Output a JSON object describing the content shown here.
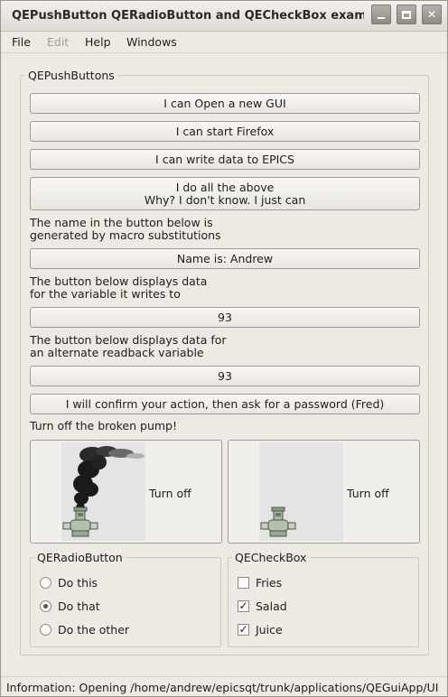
{
  "window": {
    "title": "QEPushButton QERadioButton and QECheckBox exam"
  },
  "menu": {
    "items": [
      {
        "label": "File",
        "enabled": true
      },
      {
        "label": "Edit",
        "enabled": false
      },
      {
        "label": "Help",
        "enabled": true
      },
      {
        "label": "Windows",
        "enabled": true
      }
    ]
  },
  "push_group": {
    "title": "QEPushButtons",
    "btn_open_gui": "I can Open a new GUI",
    "btn_firefox": "I can start Firefox",
    "btn_write_epics": "I can write data to EPICS",
    "btn_all_line1": "I do all the above",
    "btn_all_line2": "Why? I don't know. I just can",
    "macro_label_line1": "The name in the button below is",
    "macro_label_line2": "generated by macro substitutions",
    "btn_name": "Name is: Andrew",
    "write_label_line1": "The button below displays data",
    "write_label_line2": "for the variable it writes to",
    "btn_value_1": "93",
    "alt_label_line1": "The button below displays data for",
    "alt_label_line2": "an alternate readback variable",
    "btn_value_2": "93",
    "btn_confirm": "I will confirm your action, then ask for a password (Fred)",
    "pump_label": "Turn off the broken pump!",
    "pump_left_text": "Turn off",
    "pump_right_text": "Turn off"
  },
  "radio_group": {
    "title": "QERadioButton",
    "options": [
      {
        "label": "Do this",
        "selected": false
      },
      {
        "label": "Do that",
        "selected": true
      },
      {
        "label": "Do the other",
        "selected": false
      }
    ]
  },
  "check_group": {
    "title": "QECheckBox",
    "options": [
      {
        "label": "Fries",
        "checked": false,
        "mark": ""
      },
      {
        "label": "Salad",
        "checked": true,
        "mark": "✓"
      },
      {
        "label": "Juice",
        "checked": true,
        "mark": "✓"
      }
    ]
  },
  "status": {
    "text": "Information: Opening /home/andrew/epicsqt/trunk/applications/QEGuiApp/UI"
  }
}
